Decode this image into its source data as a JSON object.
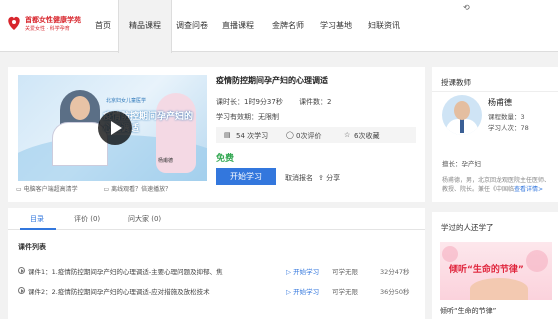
{
  "brand": {
    "name": "首都女性健康学苑",
    "slogan": "关爱女性 · 科学孕育",
    "color": "#d8262d"
  },
  "nav": [
    "首页",
    "精品课程",
    "调查问卷",
    "直播课程",
    "金牌名师",
    "学习基地",
    "妇联资讯"
  ],
  "nav_active_index": 1,
  "course": {
    "title": "疫情防控期间孕产妇的心理调适",
    "duration": "课时长：1时9分37秒",
    "lesson_count": "课件数：2",
    "validity": "学习有效期：无限制",
    "learners": "54 次学习",
    "reviews": "0次评价",
    "favorites": "6次收藏",
    "price": "免费",
    "start_label": "开始学习",
    "cancel_label": "取消报名",
    "share_label": "分享",
    "thumb_title": "疫情防控期间孕产妇的心理调适",
    "thumb_sub": "北京妇女儿童医学",
    "thumb_name": "杨甫德"
  },
  "links": [
    "电脑客户端超高清学",
    "离线观看？倍速播放？"
  ],
  "tabs": [
    "目录",
    "评价 (0)",
    "问大家 (0)"
  ],
  "lessons_heading": "课件列表",
  "lessons": [
    {
      "title": "课件1：1.疫情防控期间孕产妇的心理调适-主要心理问题及抑郁、焦",
      "action": "开始学习",
      "access": "可学无限",
      "duration": "32分47秒"
    },
    {
      "title": "课件2：2.疫情防控期间孕产妇的心理调适-应对措施及放松技术",
      "action": "开始学习",
      "access": "可学无限",
      "duration": "36分50秒"
    }
  ],
  "teacher": {
    "heading": "授课教师",
    "name": "杨甫德",
    "courses": "课程数量：3",
    "students": "学习人次：78",
    "specialty": "擅长：孕产妇",
    "bio": "杨甫德，男，北京回龙观医院主任医师、教授、院长。兼任《中国临",
    "more": "查看详情>"
  },
  "learned": {
    "heading": "学过的人还学了",
    "banner_text": "倾听“生命的节律”",
    "caption": "倾听“生命的节律”"
  },
  "accent": "#3377dd",
  "success": "#34a853"
}
